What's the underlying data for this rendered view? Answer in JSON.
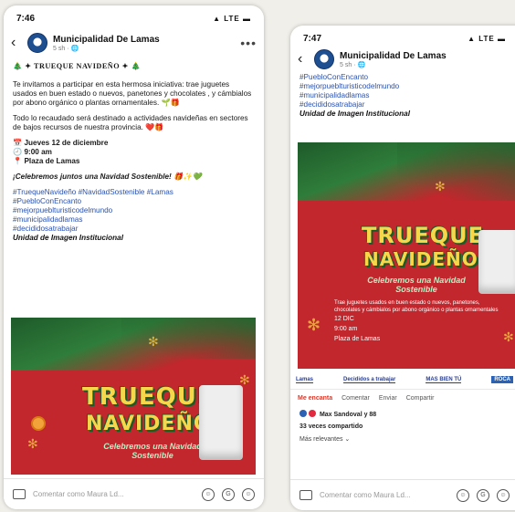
{
  "left": {
    "status": {
      "time": "7:46",
      "icons": "▲ LTE ▬"
    },
    "header": {
      "back": "‹",
      "page_name": "Municipalidad De Lamas",
      "meta": "5 sh · 🌐",
      "more": "•••"
    },
    "title_line": "🎄 ✦ TRUEQUE NAVIDEÑO ✦ 🎄",
    "paragraphs": [
      "Te invitamos a participar en esta hermosa iniciativa: trae juguetes usados en buen estado o nuevos, panetones y chocolates , y cámbialos por abono orgánico o plantas ornamentales. 🌱🎁",
      "Todo lo recaudado será destinado a actividades navideñas en sectores de bajos recursos de nuestra provincia. ❤️🎁",
      "📅 Jueves 12 de diciembre\n🕘 9:00 am\n📍 Plaza de Lamas",
      "¡Celebremos juntos una Navidad Sostenible! 🎁✨💚"
    ],
    "hashtags": [
      "#TruequeNavideño #NavidadSostenible #Lamas",
      "#PuebloConEncanto",
      "#mejorpueblturisticodelmundo",
      "#municipalidadlamas",
      "#decididosatrabajar"
    ],
    "unit": "Unidad de Imagen Institucional",
    "poster": {
      "title1": "TRUEQUE",
      "title2": "NAVIDEÑO",
      "subtitle": "Celebremos una Navidad Sostenible"
    },
    "comment_placeholder": "Comentar como Maura Ld..."
  },
  "right": {
    "status": {
      "time": "7:47",
      "icons": "▲ LTE ▬"
    },
    "header": {
      "back": "‹",
      "page_name": "Municipalidad De Lamas",
      "meta": "5 sh · 🌐"
    },
    "hashtags": [
      "#PuebloConEncanto",
      "#mejorpueblturisticodelmundo",
      "#municipalidadlamas",
      "#decididosatrabajar"
    ],
    "unit": "Unidad de Imagen Institucional",
    "poster": {
      "title1": "TRUEQUE",
      "title2": "NAVIDEÑO",
      "subtitle": "Celebremos una Navidad Sostenible",
      "info": [
        "Trae juguetes usados en buen estado o nuevos, panetones, chocolates y cámbialos por abono orgánico o plantas ornamentales",
        "12 DIC",
        "9:00 am",
        "Plaza de Lamas"
      ]
    },
    "logos": [
      "Lamas",
      "Decididos a trabajar",
      "MAS BIEN TÚ",
      "ROCA"
    ],
    "actions": {
      "like": "Me encanta",
      "comment": "Comentar",
      "share": "Enviar",
      "repost": "Compartir"
    },
    "reactions": "Max Sandoval y 88",
    "shares": "33 veces compartido",
    "sort": "Más relevantes ⌄",
    "comment_placeholder": "Comentar como Maura Ld..."
  },
  "colors": {
    "poster_red": "#c1272d",
    "poster_green": "#1e5a2a",
    "title_yellow": "#f7d64a",
    "link_blue": "#2a52b0"
  }
}
